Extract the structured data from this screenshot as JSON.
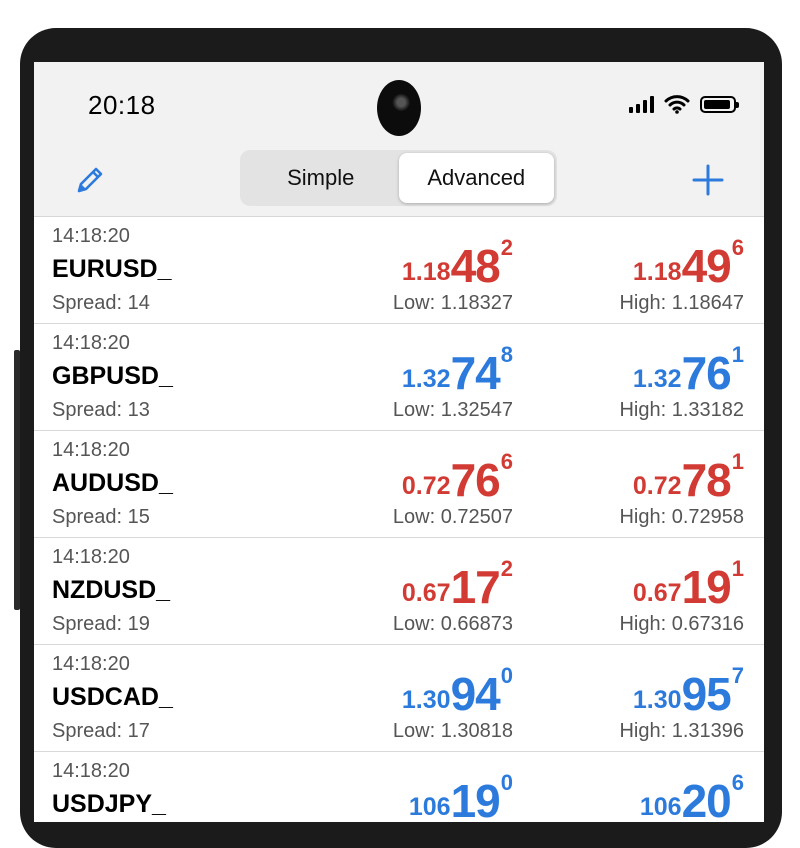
{
  "status_bar": {
    "time": "20:18"
  },
  "nav": {
    "tabs": [
      {
        "label": "Simple"
      },
      {
        "label": "Advanced"
      }
    ],
    "active_tab": "Advanced"
  },
  "colors": {
    "down": "#d23a34",
    "up": "#2c7bdc"
  },
  "quotes": [
    {
      "time": "14:18:20",
      "symbol": "EURUSD_",
      "spread": "Spread: 14",
      "direction": "down",
      "bid": {
        "small": "1.18",
        "big": "48",
        "sup": "2"
      },
      "ask": {
        "small": "1.18",
        "big": "49",
        "sup": "6"
      },
      "low": "Low: 1.18327",
      "high": "High: 1.18647"
    },
    {
      "time": "14:18:20",
      "symbol": "GBPUSD_",
      "spread": "Spread: 13",
      "direction": "up",
      "bid": {
        "small": "1.32",
        "big": "74",
        "sup": "8"
      },
      "ask": {
        "small": "1.32",
        "big": "76",
        "sup": "1"
      },
      "low": "Low: 1.32547",
      "high": "High: 1.33182"
    },
    {
      "time": "14:18:20",
      "symbol": "AUDUSD_",
      "spread": "Spread: 15",
      "direction": "down",
      "bid": {
        "small": "0.72",
        "big": "76",
        "sup": "6"
      },
      "ask": {
        "small": "0.72",
        "big": "78",
        "sup": "1"
      },
      "low": "Low: 0.72507",
      "high": "High: 0.72958"
    },
    {
      "time": "14:18:20",
      "symbol": "NZDUSD_",
      "spread": "Spread: 19",
      "direction": "down",
      "bid": {
        "small": "0.67",
        "big": "17",
        "sup": "2"
      },
      "ask": {
        "small": "0.67",
        "big": "19",
        "sup": "1"
      },
      "low": "Low: 0.66873",
      "high": "High: 0.67316"
    },
    {
      "time": "14:18:20",
      "symbol": "USDCAD_",
      "spread": "Spread: 17",
      "direction": "up",
      "bid": {
        "small": "1.30",
        "big": "94",
        "sup": "0"
      },
      "ask": {
        "small": "1.30",
        "big": "95",
        "sup": "7"
      },
      "low": "Low: 1.30818",
      "high": "High: 1.31396"
    },
    {
      "time": "14:18:20",
      "symbol": "USDJPY_",
      "spread": "",
      "direction": "up",
      "bid": {
        "small": "106",
        "big": "19",
        "sup": "0"
      },
      "ask": {
        "small": "106",
        "big": "20",
        "sup": "6"
      },
      "low": "",
      "high": ""
    }
  ]
}
